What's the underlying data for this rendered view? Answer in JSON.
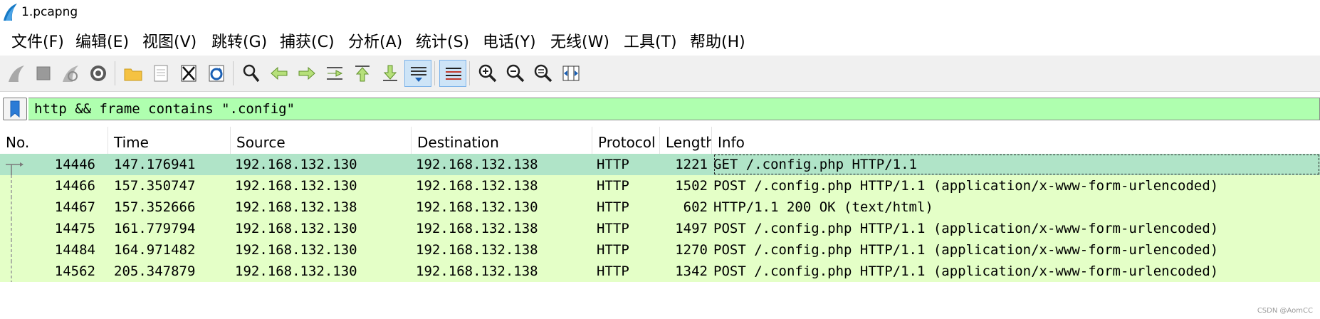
{
  "window": {
    "title": "1.pcapng"
  },
  "menu": [
    {
      "label": "文件(F)",
      "name": "menu-file"
    },
    {
      "label": "编辑(E)",
      "name": "menu-edit"
    },
    {
      "label": "视图(V)",
      "name": "menu-view"
    },
    {
      "label": "跳转(G)",
      "name": "menu-go"
    },
    {
      "label": "捕获(C)",
      "name": "menu-capture"
    },
    {
      "label": "分析(A)",
      "name": "menu-analyze"
    },
    {
      "label": "统计(S)",
      "name": "menu-statistics"
    },
    {
      "label": "电话(Y)",
      "name": "menu-telephony"
    },
    {
      "label": "无线(W)",
      "name": "menu-wireless"
    },
    {
      "label": "工具(T)",
      "name": "menu-tools"
    },
    {
      "label": "帮助(H)",
      "name": "menu-help"
    }
  ],
  "toolbar": {
    "icons": [
      "start-capture-icon",
      "stop-capture-icon",
      "restart-capture-icon",
      "capture-options-icon",
      "open-file-icon",
      "save-file-icon",
      "close-file-icon",
      "reload-file-icon",
      "find-packet-icon",
      "go-back-icon",
      "go-forward-icon",
      "go-to-packet-icon",
      "first-packet-icon",
      "last-packet-icon",
      "autoscroll-icon",
      "colorize-icon",
      "zoom-in-icon",
      "zoom-out-icon",
      "normal-size-icon",
      "resize-columns-icon"
    ]
  },
  "filter": {
    "value": "http && frame contains \".config\"",
    "bg_color": "#afffaf"
  },
  "packet_list": {
    "columns": [
      "No.",
      "Time",
      "Source",
      "Destination",
      "Protocol",
      "Length",
      "Info"
    ],
    "rows": [
      {
        "no": "14446",
        "time": "147.176941",
        "source": "192.168.132.130",
        "destination": "192.168.132.138",
        "protocol": "HTTP",
        "length": "1221",
        "info": "GET /.config.php HTTP/1.1",
        "selected": true
      },
      {
        "no": "14466",
        "time": "157.350747",
        "source": "192.168.132.130",
        "destination": "192.168.132.138",
        "protocol": "HTTP",
        "length": "1502",
        "info": "POST /.config.php HTTP/1.1  (application/x-www-form-urlencoded)",
        "selected": false
      },
      {
        "no": "14467",
        "time": "157.352666",
        "source": "192.168.132.138",
        "destination": "192.168.132.130",
        "protocol": "HTTP",
        "length": "602",
        "info": "HTTP/1.1 200 OK  (text/html)",
        "selected": false
      },
      {
        "no": "14475",
        "time": "161.779794",
        "source": "192.168.132.130",
        "destination": "192.168.132.138",
        "protocol": "HTTP",
        "length": "1497",
        "info": "POST /.config.php HTTP/1.1  (application/x-www-form-urlencoded)",
        "selected": false
      },
      {
        "no": "14484",
        "time": "164.971482",
        "source": "192.168.132.130",
        "destination": "192.168.132.138",
        "protocol": "HTTP",
        "length": "1270",
        "info": "POST /.config.php HTTP/1.1  (application/x-www-form-urlencoded)",
        "selected": false
      },
      {
        "no": "14562",
        "time": "205.347879",
        "source": "192.168.132.130",
        "destination": "192.168.132.138",
        "protocol": "HTTP",
        "length": "1342",
        "info": "POST /.config.php HTTP/1.1  (application/x-www-form-urlencoded)",
        "selected": false
      }
    ],
    "colors": {
      "http_row": "#e4ffc7",
      "selected_row": "#b0e4c8"
    }
  },
  "watermark": "CSDN @AomCC"
}
